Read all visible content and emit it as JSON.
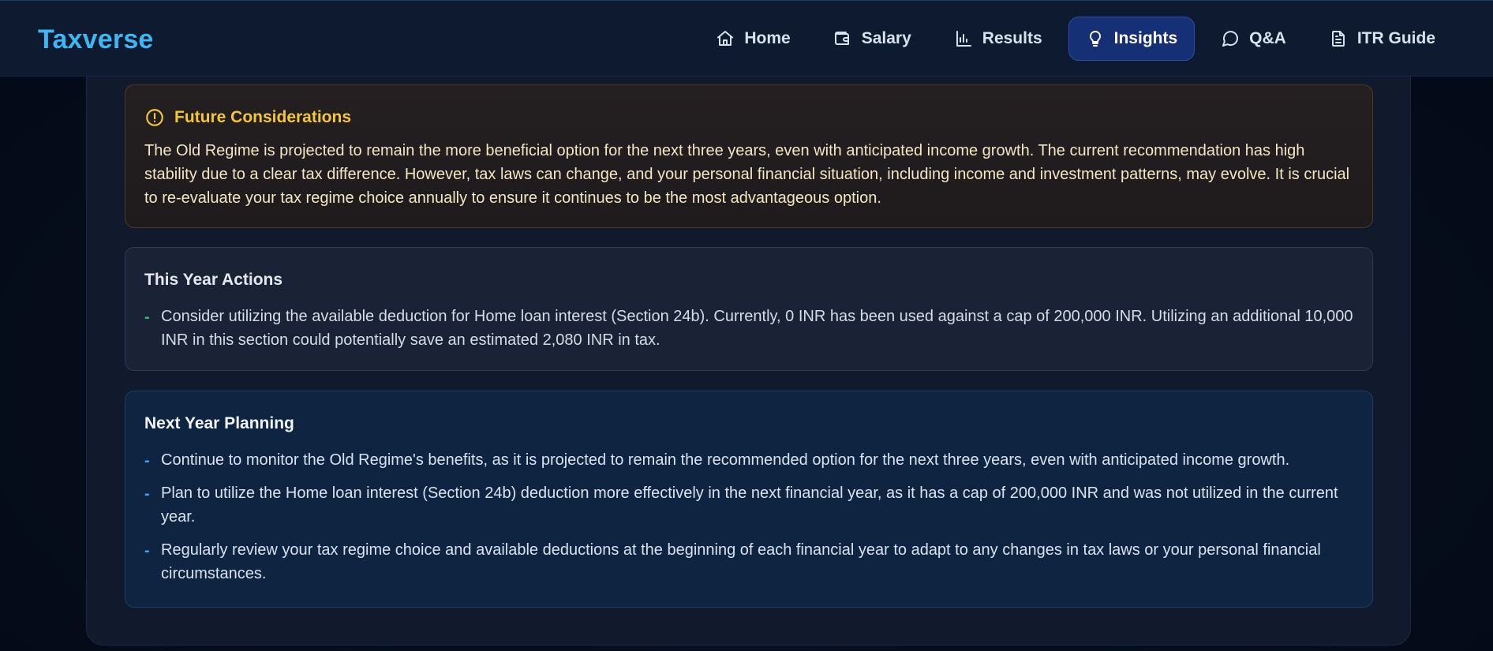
{
  "brand": "Taxverse",
  "nav": {
    "items": [
      {
        "label": "Home",
        "icon": "home-icon"
      },
      {
        "label": "Salary",
        "icon": "wallet-icon"
      },
      {
        "label": "Results",
        "icon": "bar-chart-icon"
      },
      {
        "label": "Insights",
        "icon": "lightbulb-icon",
        "active": true
      },
      {
        "label": "Q&A",
        "icon": "chat-bubble-icon"
      },
      {
        "label": "ITR Guide",
        "icon": "document-icon"
      }
    ]
  },
  "future": {
    "title": "Future Considerations",
    "icon": "alert-circle-icon",
    "text": "The Old Regime is projected to remain the more beneficial option for the next three years, even with anticipated income growth. The current recommendation has high stability due to a clear tax difference. However, tax laws can change, and your personal financial situation, including income and investment patterns, may evolve. It is crucial to re-evaluate your tax regime choice annually to ensure it continues to be the most advantageous option."
  },
  "this_year": {
    "title": "This Year Actions",
    "items": [
      "Consider utilizing the available deduction for Home loan interest (Section 24b). Currently, 0 INR has been used against a cap of 200,000 INR. Utilizing an additional 10,000 INR in this section could potentially save an estimated 2,080 INR in tax."
    ]
  },
  "next_year": {
    "title": "Next Year Planning",
    "items": [
      "Continue to monitor the Old Regime's benefits, as it is projected to remain the recommended option for the next three years, even with anticipated income growth.",
      "Plan to utilize the Home loan interest (Section 24b) deduction more effectively in the next financial year, as it has a cap of 200,000 INR and was not utilized in the current year.",
      "Regularly review your tax regime choice and available deductions at the beginning of each financial year to adapt to any changes in tax laws or your personal financial circumstances."
    ]
  },
  "bullet": "-",
  "colors": {
    "brand": "#3fb6f2",
    "active_nav": "#163076",
    "warning": "#f5c63a",
    "action_bullet": "#2fbf71",
    "plan_bullet": "#3fa7f0"
  }
}
